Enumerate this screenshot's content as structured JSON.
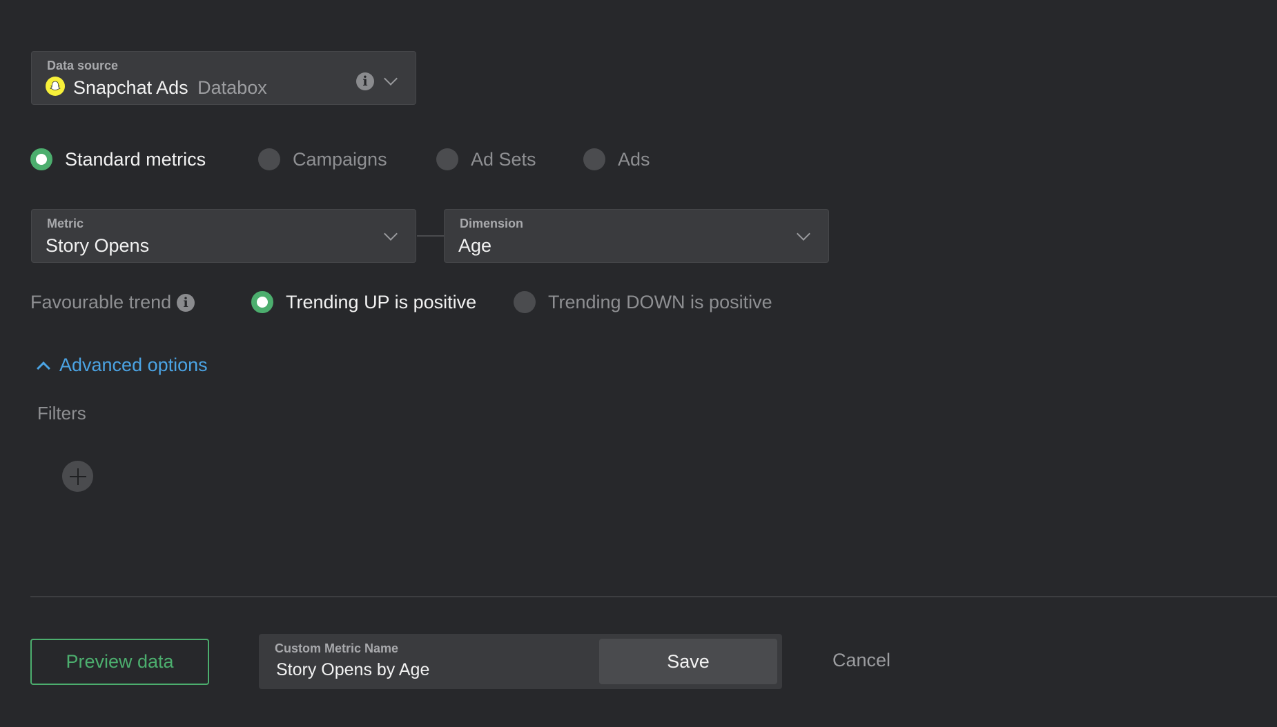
{
  "data_source": {
    "label": "Data source",
    "name": "Snapchat Ads",
    "provider": "Databox",
    "icon": "snapchat-ads-icon",
    "icon_badge": "Ads"
  },
  "metric_type": {
    "options": [
      "Standard metrics",
      "Campaigns",
      "Ad Sets",
      "Ads"
    ],
    "selected": "Standard metrics"
  },
  "metric": {
    "label": "Metric",
    "value": "Story Opens"
  },
  "dimension": {
    "label": "Dimension",
    "value": "Age"
  },
  "favourable_trend": {
    "label": "Favourable trend",
    "options": [
      "Trending UP is positive",
      "Trending DOWN is positive"
    ],
    "selected": "Trending UP is positive"
  },
  "advanced": {
    "toggle_label": "Advanced options",
    "filters_label": "Filters"
  },
  "footer": {
    "preview_label": "Preview data",
    "custom_name_label": "Custom Metric Name",
    "custom_name_value": "Story Opens by Age",
    "save_label": "Save",
    "cancel_label": "Cancel"
  },
  "colors": {
    "accent_green": "#4cae6e",
    "link_blue": "#4ba3e3",
    "background": "#27282b"
  }
}
